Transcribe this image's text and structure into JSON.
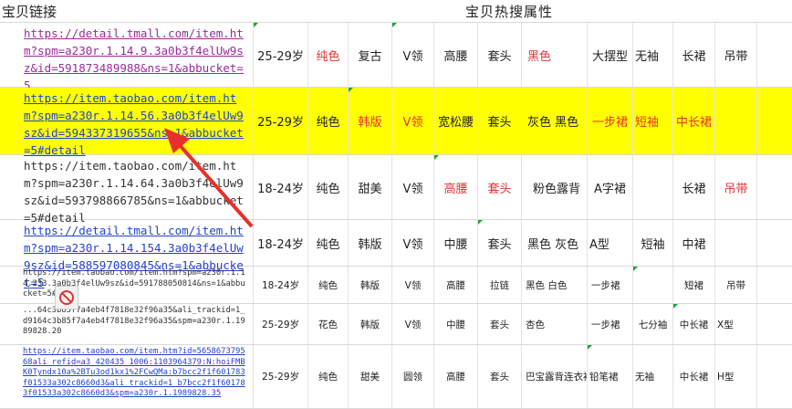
{
  "header": {
    "left": "宝贝链接",
    "right": "宝贝热搜属性"
  },
  "rows": [
    {
      "link": "https://detail.tmall.com/item.htm?spm=a230r.1.14.9.3a0b3f4elUw9sz&id=591873489988&ns=1&abbucket=5",
      "cells": [
        "25-29岁",
        "纯色",
        "复古",
        "V领",
        "高腰",
        "套头",
        "黑色",
        "大摆型",
        "无袖",
        "长裙",
        "吊带"
      ]
    },
    {
      "link": "https://item.taobao.com/item.htm?spm=a230r.1.14.56.3a0b3f4elUw9sz&id=594337319655&ns=1&abbucket=5#detail",
      "cells": [
        "25-29岁",
        "纯色",
        "韩版",
        "V领",
        "宽松腰",
        "套头",
        "灰色 黑色",
        "一步裙",
        "短袖",
        "中长裙",
        ""
      ]
    },
    {
      "link": "https://item.taobao.com/item.htm?spm=a230r.1.14.64.3a0b3f4elUw9sz&id=593798866785&ns=1&abbucket=5#detail",
      "cells": [
        "18-24岁",
        "纯色",
        "甜美",
        "V领",
        "高腰",
        "套头",
        "粉色露背",
        "A字裙",
        "",
        "长裙",
        "吊带"
      ]
    },
    {
      "link": "https://detail.tmall.com/item.htm?spm=a230r.1.14.154.3a0b3f4elUw9sz&id=588597080845&ns=1&abbucket=5",
      "cells": [
        "18-24岁",
        "纯色",
        "韩版",
        "V领",
        "中腰",
        "套头",
        "黑色 灰色",
        "A型",
        "短袖",
        "中裙",
        ""
      ]
    },
    {
      "link": "https://item.taobao.com/item.htm?spm=a230r.1.14.233.3a0b3f4elUw9sz&id=591788050814&ns=1&abbucket=5#",
      "cells": [
        "18-24岁",
        "纯色",
        "韩版",
        "V领",
        "高腰",
        "拉链",
        "黑色 白色",
        "一步裙",
        "",
        "短裙",
        "吊带"
      ]
    },
    {
      "link": "...64c3b85f7a4eb4f7818e32f96a35&ali_trackid=1_d9164c3b85f7a4eb4f7818e32f96a35&spm=a230r.1.1989828.20",
      "cells": [
        "25-29岁",
        "花色",
        "韩版",
        "V领",
        "中腰",
        "套头",
        "杏色",
        "一步裙",
        "七分袖",
        "中长裙",
        "X型"
      ]
    },
    {
      "link": "https://item.taobao.com/item.htm?id=565867379568ali_refid=a3_420435_1006:1103964379:N:hoiFMBK0Tyndx10a%2BTu3od1kx1%2FCwQMa:b7bcc2f1f601783f01533a302c8660d3&ali_trackid=1_b7bcc2f1f601783f01533a302c8660d3&spm=a230r.1.1989828.35",
      "cells": [
        "25-29岁",
        "纯色",
        "甜美",
        "圆领",
        "高腰",
        "套头",
        "巴宝露背连衣裙",
        "铅笔裙",
        "无袖",
        "中长裙",
        "H型"
      ]
    }
  ],
  "icons": {
    "arrow": "red-arrow-annotation",
    "no": "prohibited-icon"
  }
}
